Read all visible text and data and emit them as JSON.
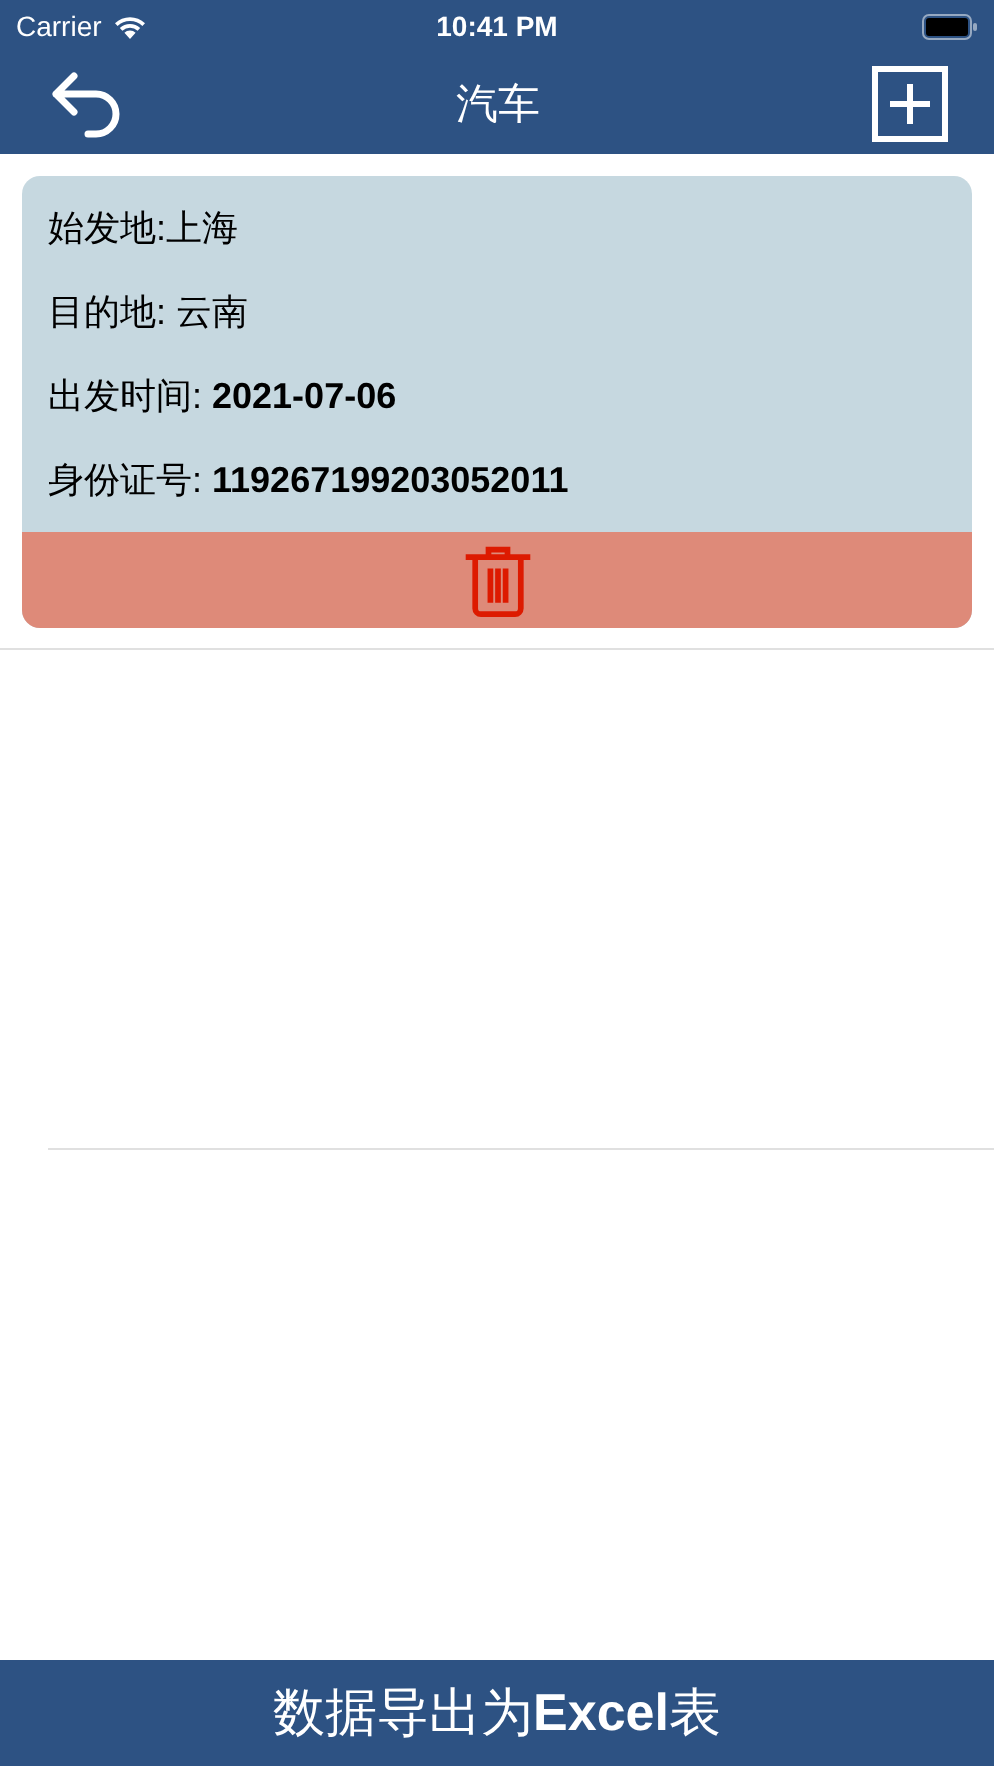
{
  "status_bar": {
    "carrier": "Carrier",
    "time": "10:41 PM"
  },
  "nav_bar": {
    "title": "汽车"
  },
  "records": [
    {
      "lines": [
        "始发地:上海",
        "目的地: 云南",
        "出发时间: **2021-07-06**",
        "身份证号: **119267199203052011**"
      ]
    }
  ],
  "export_button": {
    "label": "数据导出为**Excel**表"
  }
}
